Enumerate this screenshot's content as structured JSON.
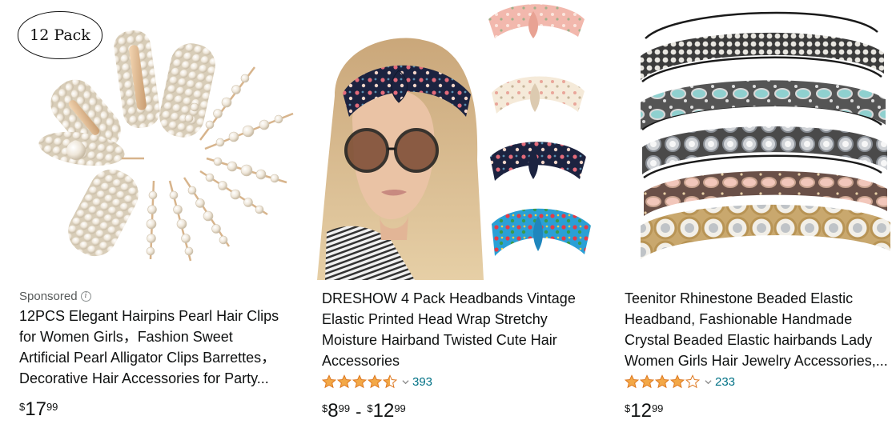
{
  "products": [
    {
      "sponsored_label": "Sponsored",
      "badge_text": "12 Pack",
      "title_lines": [
        "12PCS Elegant Hairpins Pearl Hair Clips",
        "for Women Girls，Fashion Sweet",
        "Artificial Pearl Alligator Clips Barrettes，",
        "Decorative Hair Accessories for Party..."
      ],
      "price": {
        "symbol": "$",
        "whole": "17",
        "fraction": "99"
      }
    },
    {
      "title_lines": [
        "DRESHOW 4 Pack Headbands Vintage",
        "Elastic Printed Head Wrap Stretchy",
        "Moisture Hairband Twisted Cute Hair",
        "Accessories"
      ],
      "rating": {
        "stars": 4.5,
        "count": "393"
      },
      "price_range": {
        "low": {
          "symbol": "$",
          "whole": "8",
          "fraction": "99"
        },
        "separator": "-",
        "high": {
          "symbol": "$",
          "whole": "12",
          "fraction": "99"
        }
      }
    },
    {
      "title_lines": [
        "Teenitor Rhinestone Beaded Elastic",
        "Headband, Fashionable Handmade",
        "Crystal Beaded Elastic hairbands Lady",
        "Women Girls Hair Jewelry Accessories,..."
      ],
      "rating": {
        "stars": 4,
        "count": "233"
      },
      "price": {
        "symbol": "$",
        "whole": "12",
        "fraction": "99"
      }
    }
  ],
  "colors": {
    "star": "#f3a847",
    "link": "#007185",
    "text": "#0f1111",
    "muted": "#565959"
  }
}
